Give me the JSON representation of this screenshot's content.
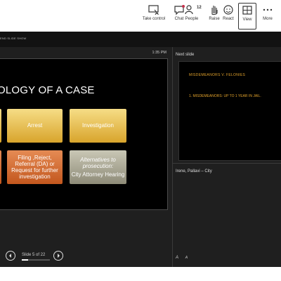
{
  "toolbar": {
    "take_control": "Take control",
    "chat": "Chat",
    "people": "People",
    "people_count": "12",
    "raise": "Raise",
    "react": "React",
    "view": "View",
    "more": "More"
  },
  "presentation": {
    "end_show": "END SLIDE SHOW",
    "time": "1:35 PM",
    "slide": {
      "title": "OLOGY OF A CASE",
      "boxes": [
        {
          "text": "Arrest",
          "style": "gold"
        },
        {
          "text": "Investigation",
          "style": "gold"
        },
        {
          "text": "Filing ,Reject, Referral (DA) or Request for further investigation",
          "style": "orange"
        },
        {
          "text_italic": "Alternatives to prosecution:",
          "text": "City Attorney Hearing",
          "style": "gray"
        }
      ]
    },
    "nav": {
      "slide_counter": "Slide 5 of 22",
      "progress": 0.227
    }
  },
  "next_slide": {
    "label": "Next slide",
    "title": "MISDEMEANORS V. FELONIES",
    "bullet": "1. MISDEMEANORS: UP TO 1 YEAR IN JAIL."
  },
  "notes": {
    "text": "Irene, Pallavi – City"
  },
  "font_controls": {
    "larger": "A",
    "smaller": "A"
  },
  "colors": {
    "accent_orange": "#e0a12b",
    "stage_bg": "#1f1f1f"
  }
}
